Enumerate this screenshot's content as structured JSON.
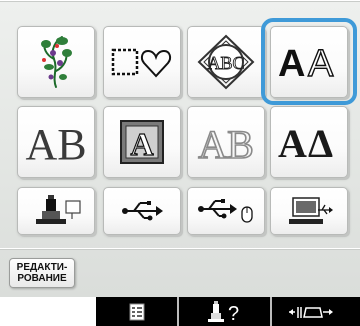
{
  "pattern_buttons": [
    {
      "icon": "embroidery-pattern-icon"
    },
    {
      "icon": "frame-pattern-icon"
    },
    {
      "icon": "monogram-pattern-icon"
    },
    {
      "icon": "character-font-icon",
      "text": "AA",
      "selected": true
    },
    {
      "icon": "decorative-alphabet-icon",
      "text": "AB"
    },
    {
      "icon": "decorative-letter-icon",
      "text": "A"
    },
    {
      "icon": "outline-alphabet-icon",
      "text": "AB"
    },
    {
      "icon": "greek-alphabet-icon",
      "text": "AΔ"
    }
  ],
  "memory_buttons": [
    {
      "icon": "machine-memory-icon"
    },
    {
      "icon": "usb-media-icon"
    },
    {
      "icon": "usb-mouse-icon"
    },
    {
      "icon": "computer-icon"
    }
  ],
  "edit_button": {
    "line1": "РЕДАКТИ-",
    "line2": "РОВАНИЕ"
  },
  "bottom_bar": [
    {
      "icon": "reference-sheet-icon"
    },
    {
      "icon": "help-icon",
      "text": "?"
    },
    {
      "icon": "bobbin-winding-icon"
    }
  ],
  "colors": {
    "selection": "#3f9ad8",
    "bar": "#000000"
  }
}
